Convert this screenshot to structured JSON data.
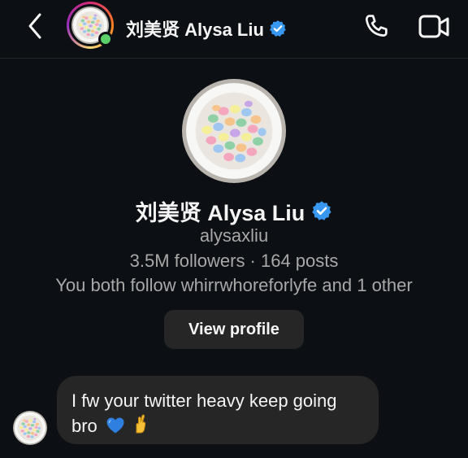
{
  "header": {
    "name": "刘美贤 Alysa Liu",
    "back_icon": "chevron-left-icon",
    "call_icon": "phone-icon",
    "video_icon": "video-camera-icon",
    "online": true
  },
  "profile": {
    "name": "刘美贤 Alysa Liu",
    "verified": true,
    "username": "alysaxliu",
    "stats": "3.5M followers · 164 posts",
    "mutual": "You both follow whirrwhoreforlyfe and 1 other",
    "view_profile_label": "View profile"
  },
  "messages": [
    {
      "from": "them",
      "text": "I fw your twitter heavy keep going bro",
      "emojis": [
        "blue-heart-icon",
        "crossed-fingers-icon"
      ]
    }
  ],
  "colors": {
    "background": "#0c1014",
    "bubble": "#262626",
    "button": "#262626",
    "verified": "#3897f0",
    "online": "#5bd069",
    "secondary_text": "#a8a8a8"
  }
}
